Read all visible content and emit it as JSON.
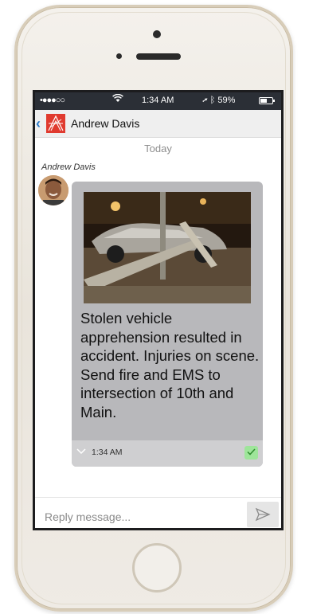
{
  "status_bar": {
    "signal": "•●●●○○",
    "time": "1:34 AM",
    "battery": "59%",
    "battery_level": 0.59
  },
  "header": {
    "contact_name": "Andrew Davis"
  },
  "conversation": {
    "date_separator": "Today",
    "messages": [
      {
        "sender": "Andrew Davis",
        "text": "Stolen vehicle apprehension resulted in accident. Injuries on scene. Send fire and EMS to intersection of 10th and Main.",
        "time": "1:34 AM",
        "status": "delivered"
      }
    ]
  },
  "reply": {
    "placeholder": "Reply message..."
  },
  "colors": {
    "status_bar_bg": "#2b2f36",
    "nav_bg": "#efefef",
    "bubble_bg": "#b8b8bb",
    "bubble_footer_bg": "#cfcfd1",
    "delivered_check": "#9ee59a",
    "logo_red": "#e03a2f",
    "back_blue": "#2a7ac9"
  },
  "icons": {
    "back": "chevron-left-icon",
    "wifi": "wifi-icon",
    "location": "location-arrow-icon",
    "bluetooth": "bluetooth-icon",
    "battery": "battery-icon",
    "expand": "chevron-down-icon",
    "read_receipt": "check-icon",
    "send": "send-icon"
  }
}
